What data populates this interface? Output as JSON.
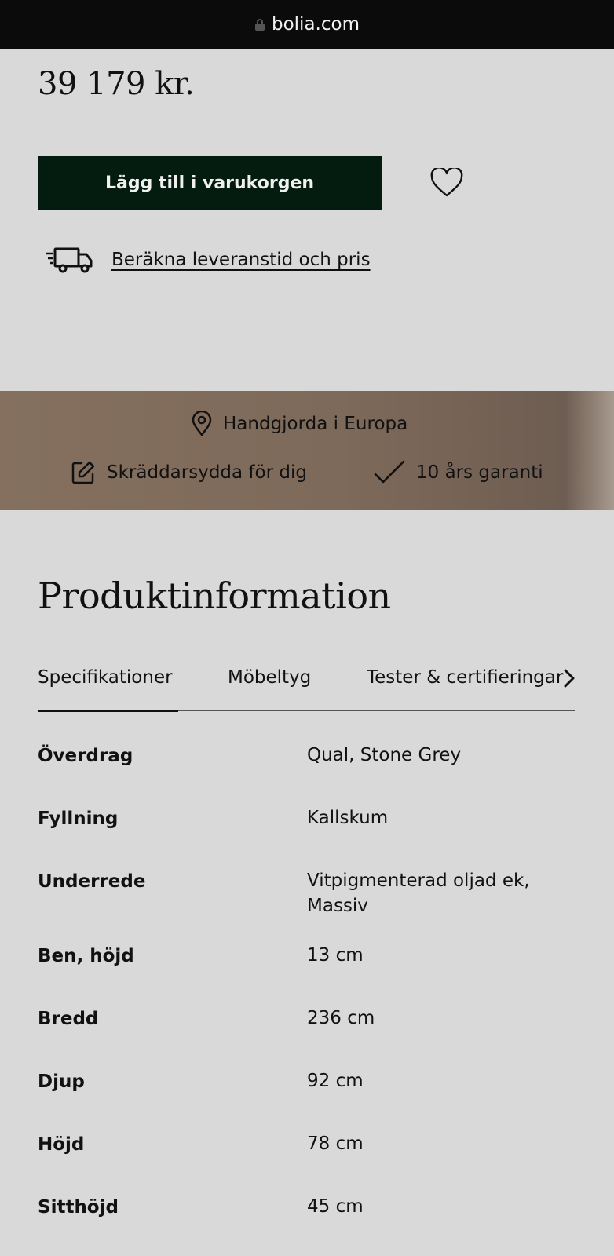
{
  "browser": {
    "url": "bolia.com"
  },
  "product": {
    "price": "39 179 kr."
  },
  "actions": {
    "add_to_cart": "Lägg till i varukorgen",
    "delivery_link": "Beräkna leveranstid och pris"
  },
  "usps": [
    {
      "icon": "location-pin-icon",
      "label": "Handgjorda i Europa"
    },
    {
      "icon": "edit-icon",
      "label": "Skräddarsydda för dig"
    },
    {
      "icon": "check-icon",
      "label": "10 års garanti"
    }
  ],
  "product_info": {
    "title": "Produktinformation",
    "tabs": [
      {
        "label": "Specifikationer",
        "active": true
      },
      {
        "label": "Möbeltyg",
        "active": false
      },
      {
        "label": "Tester & certifieringar",
        "active": false
      }
    ],
    "specs": [
      {
        "label": "Överdrag",
        "value": "Qual, Stone Grey"
      },
      {
        "label": "Fyllning",
        "value": "Kallskum"
      },
      {
        "label": "Underrede",
        "value": "Vitpigmenterad oljad ek, Massiv"
      },
      {
        "label": "Ben, höjd",
        "value": "13 cm"
      },
      {
        "label": "Bredd",
        "value": "236 cm"
      },
      {
        "label": "Djup",
        "value": "92 cm"
      },
      {
        "label": "Höjd",
        "value": "78 cm"
      },
      {
        "label": "Sitthöjd",
        "value": "45 cm"
      }
    ]
  },
  "colors": {
    "cart_button": "#031c0f",
    "usp_band": "#85705f",
    "page_background": "#d9d9d9"
  }
}
